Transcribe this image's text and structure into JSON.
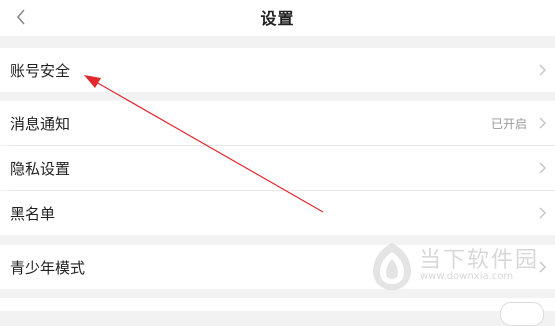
{
  "header": {
    "title": "设置",
    "back_icon": "chevron-left-icon"
  },
  "sections": {
    "account": {
      "items": [
        {
          "label": "账号安全",
          "value": ""
        }
      ]
    },
    "general": {
      "items": [
        {
          "label": "消息通知",
          "value": "已开启"
        },
        {
          "label": "隐私设置",
          "value": ""
        },
        {
          "label": "黑名单",
          "value": ""
        }
      ]
    },
    "youth": {
      "items": [
        {
          "label": "青少年模式",
          "value": ""
        }
      ]
    }
  },
  "annotation": {
    "type": "arrow",
    "color": "#e0282f",
    "points_to": "账号安全"
  },
  "watermark": {
    "text": "当下软件园",
    "url": "www.downxia.com"
  },
  "colors": {
    "background": "#f2f2f2",
    "card": "#ffffff",
    "chevron": "#c7c7c7",
    "secondary_text": "#9a9a9a",
    "annotation": "#e0282f"
  }
}
